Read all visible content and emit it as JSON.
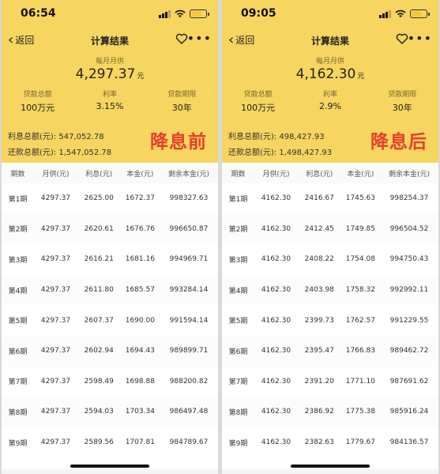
{
  "colors": {
    "header_bg": "#f6d560",
    "badge": "#e63e2c"
  },
  "table_headers": [
    "期数",
    "月供(元)",
    "利息(元)",
    "本金(元)",
    "剩余本金(元)"
  ],
  "left": {
    "time": "06:54",
    "back_label": "返回",
    "title": "计算结果",
    "monthly_label": "每月月供",
    "monthly_value": "4,297.37",
    "monthly_unit": "元",
    "loan_label": "贷款总额",
    "loan_value": "100万元",
    "rate_label": "利率",
    "rate_value": "3.15%",
    "term_label": "贷款期限",
    "term_value": "30年",
    "interest_total": "利息总额(元): 547,052.78",
    "repay_total": "还款总额(元): 1,547,052.78",
    "badge": "降息前",
    "rows": [
      [
        "第1期",
        "4297.37",
        "2625.00",
        "1672.37",
        "998327.63"
      ],
      [
        "第2期",
        "4297.37",
        "2620.61",
        "1676.76",
        "996650.87"
      ],
      [
        "第3期",
        "4297.37",
        "2616.21",
        "1681.16",
        "994969.71"
      ],
      [
        "第4期",
        "4297.37",
        "2611.80",
        "1685.57",
        "993284.14"
      ],
      [
        "第5期",
        "4297.37",
        "2607.37",
        "1690.00",
        "991594.14"
      ],
      [
        "第6期",
        "4297.37",
        "2602.94",
        "1694.43",
        "989899.71"
      ],
      [
        "第7期",
        "4297.37",
        "2598.49",
        "1698.88",
        "988200.82"
      ],
      [
        "第8期",
        "4297.37",
        "2594.03",
        "1703.34",
        "986497.48"
      ],
      [
        "第9期",
        "4297.37",
        "2589.56",
        "1707.81",
        "984789.67"
      ]
    ]
  },
  "right": {
    "time": "09:05",
    "back_label": "返回",
    "title": "计算结果",
    "monthly_label": "每月月供",
    "monthly_value": "4,162.30",
    "monthly_unit": "元",
    "loan_label": "贷款总额",
    "loan_value": "100万元",
    "rate_label": "利率",
    "rate_value": "2.9%",
    "term_label": "贷款期限",
    "term_value": "30年",
    "interest_total": "利息总额(元): 498,427.93",
    "repay_total": "还款总额(元): 1,498,427.93",
    "badge": "降息后",
    "rows": [
      [
        "第1期",
        "4162.30",
        "2416.67",
        "1745.63",
        "998254.37"
      ],
      [
        "第2期",
        "4162.30",
        "2412.45",
        "1749.85",
        "996504.52"
      ],
      [
        "第3期",
        "4162.30",
        "2408.22",
        "1754.08",
        "994750.43"
      ],
      [
        "第4期",
        "4162.30",
        "2403.98",
        "1758.32",
        "992992.11"
      ],
      [
        "第5期",
        "4162.30",
        "2399.73",
        "1762.57",
        "991229.55"
      ],
      [
        "第6期",
        "4162.30",
        "2395.47",
        "1766.83",
        "989462.72"
      ],
      [
        "第7期",
        "4162.30",
        "2391.20",
        "1771.10",
        "987691.62"
      ],
      [
        "第8期",
        "4162.30",
        "2386.92",
        "1775.38",
        "985916.24"
      ],
      [
        "第9期",
        "4162.30",
        "2382.63",
        "1779.67",
        "984136.57"
      ]
    ]
  }
}
